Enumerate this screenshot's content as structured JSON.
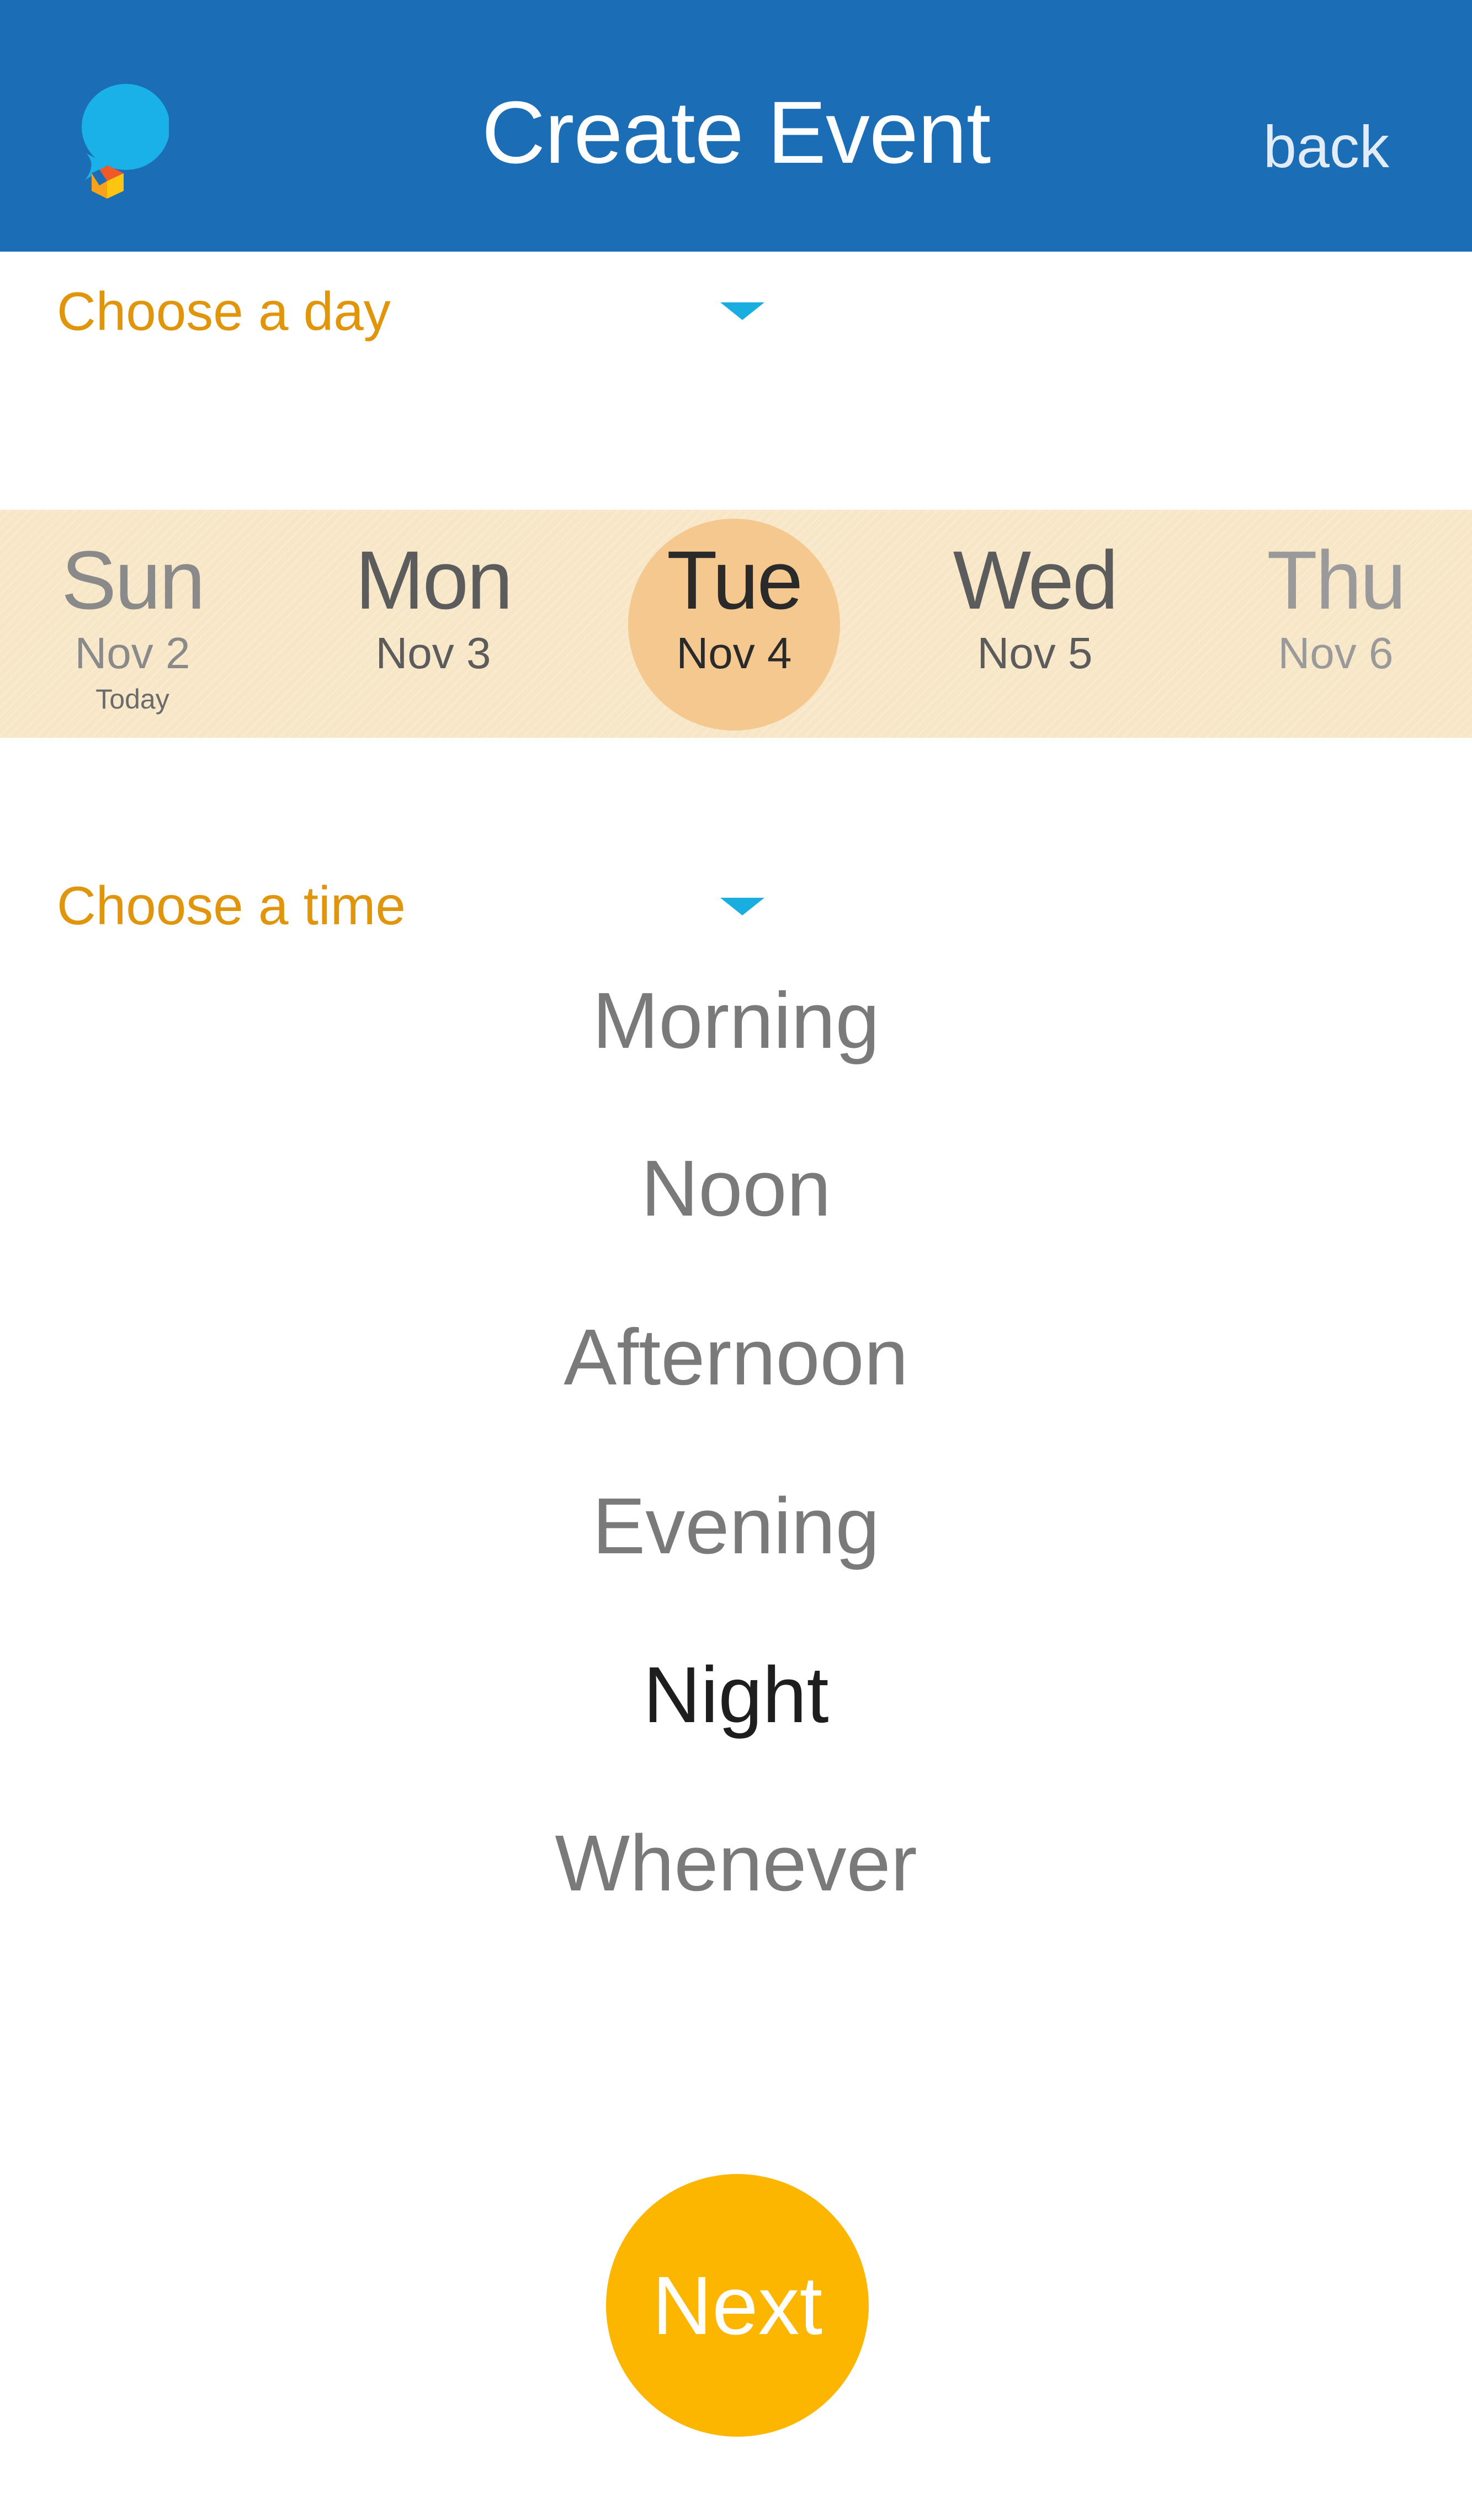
{
  "header": {
    "title": "Create Event",
    "back_label": "back",
    "logo_icon": "speech-bubble-logo-icon",
    "background_color": "#1b6db5"
  },
  "day_section": {
    "label": "Choose a day",
    "dropdown_icon": "caret-down-icon"
  },
  "days": [
    {
      "name": "Sun",
      "date": "Nov 2",
      "note": "Today",
      "selected": false
    },
    {
      "name": "Mon",
      "date": "Nov 3",
      "note": "",
      "selected": false
    },
    {
      "name": "Tue",
      "date": "Nov 4",
      "note": "",
      "selected": true
    },
    {
      "name": "Wed",
      "date": "Nov 5",
      "note": "",
      "selected": false
    },
    {
      "name": "Thu",
      "date": "Nov 6",
      "note": "",
      "selected": false
    }
  ],
  "time_section": {
    "label": "Choose a time",
    "dropdown_icon": "caret-down-icon"
  },
  "times": [
    {
      "label": "Morning",
      "selected": false
    },
    {
      "label": "Noon",
      "selected": false
    },
    {
      "label": "Afternoon",
      "selected": false
    },
    {
      "label": "Evening",
      "selected": false
    },
    {
      "label": "Night",
      "selected": true
    },
    {
      "label": "Whenever",
      "selected": false
    }
  ],
  "next_button": {
    "label": "Next",
    "color": "#fdb600"
  },
  "colors": {
    "accent_orange": "#e0950b",
    "caret_blue": "#1aaee0",
    "day_strip_bg": "#f8e7c7",
    "selected_day_circle": "#f4c88f"
  }
}
